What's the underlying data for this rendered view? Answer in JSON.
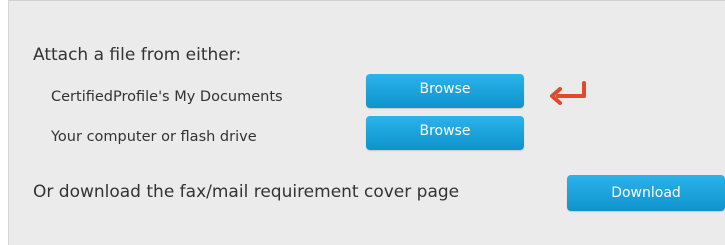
{
  "attach": {
    "heading": "Attach a file from either:",
    "my_documents_label": "CertifiedProfile's My Documents",
    "computer_label": "Your computer or flash drive",
    "browse_label_1": "Browse",
    "browse_label_2": "Browse"
  },
  "download": {
    "label": "Or download the fax/mail requirement cover page",
    "button_label": "Download"
  },
  "colors": {
    "button": "#1aa3dc",
    "arrow": "#e04a2a",
    "panel_background": "#ebebeb"
  },
  "icons": {
    "pointer": "return-arrow-icon"
  }
}
